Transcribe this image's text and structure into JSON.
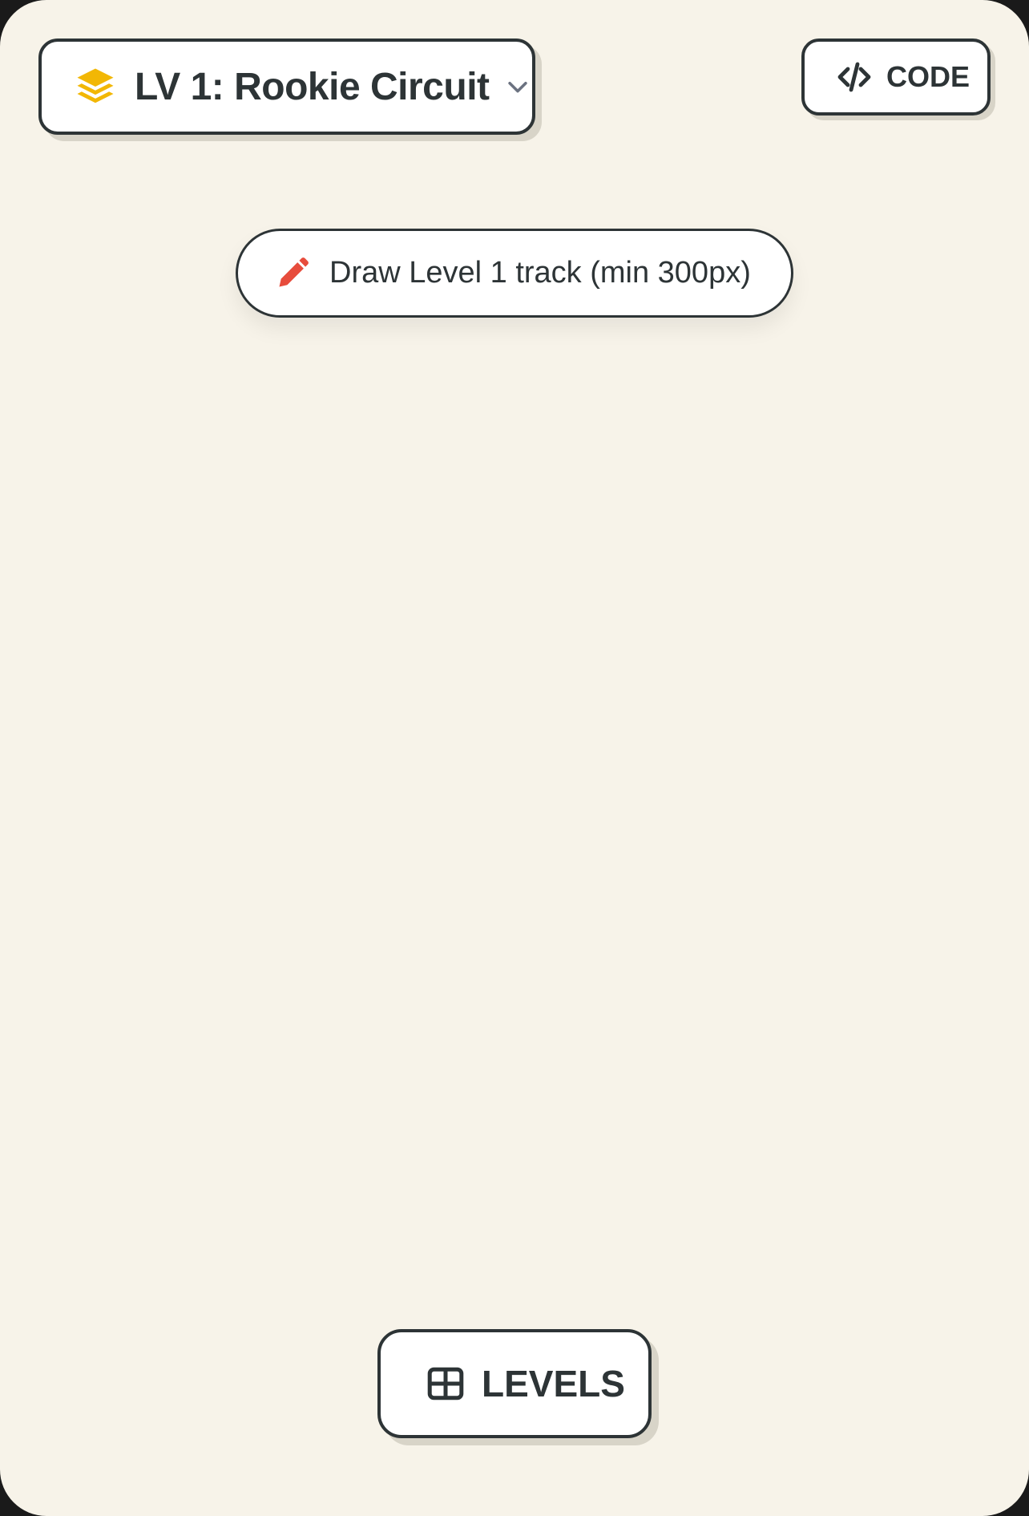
{
  "header": {
    "level_selector": {
      "label": "LV 1: Rookie Circuit",
      "icon": "layers-icon",
      "dropdown_icon": "chevron-down-icon"
    },
    "code_button": {
      "label": "CODE",
      "icon": "code-icon"
    }
  },
  "hint": {
    "text": "Draw Level 1 track (min 300px)",
    "icon": "pencil-icon"
  },
  "footer": {
    "levels_button": {
      "label": "LEVELS",
      "icon": "grid-icon"
    }
  },
  "colors": {
    "background": "#f7f3e9",
    "ink": "#2d3436",
    "accent_yellow": "#f2b705",
    "pencil_red": "#e74c3c",
    "chevron_gray": "#6b7280",
    "shadow": "#d8d4c8"
  }
}
